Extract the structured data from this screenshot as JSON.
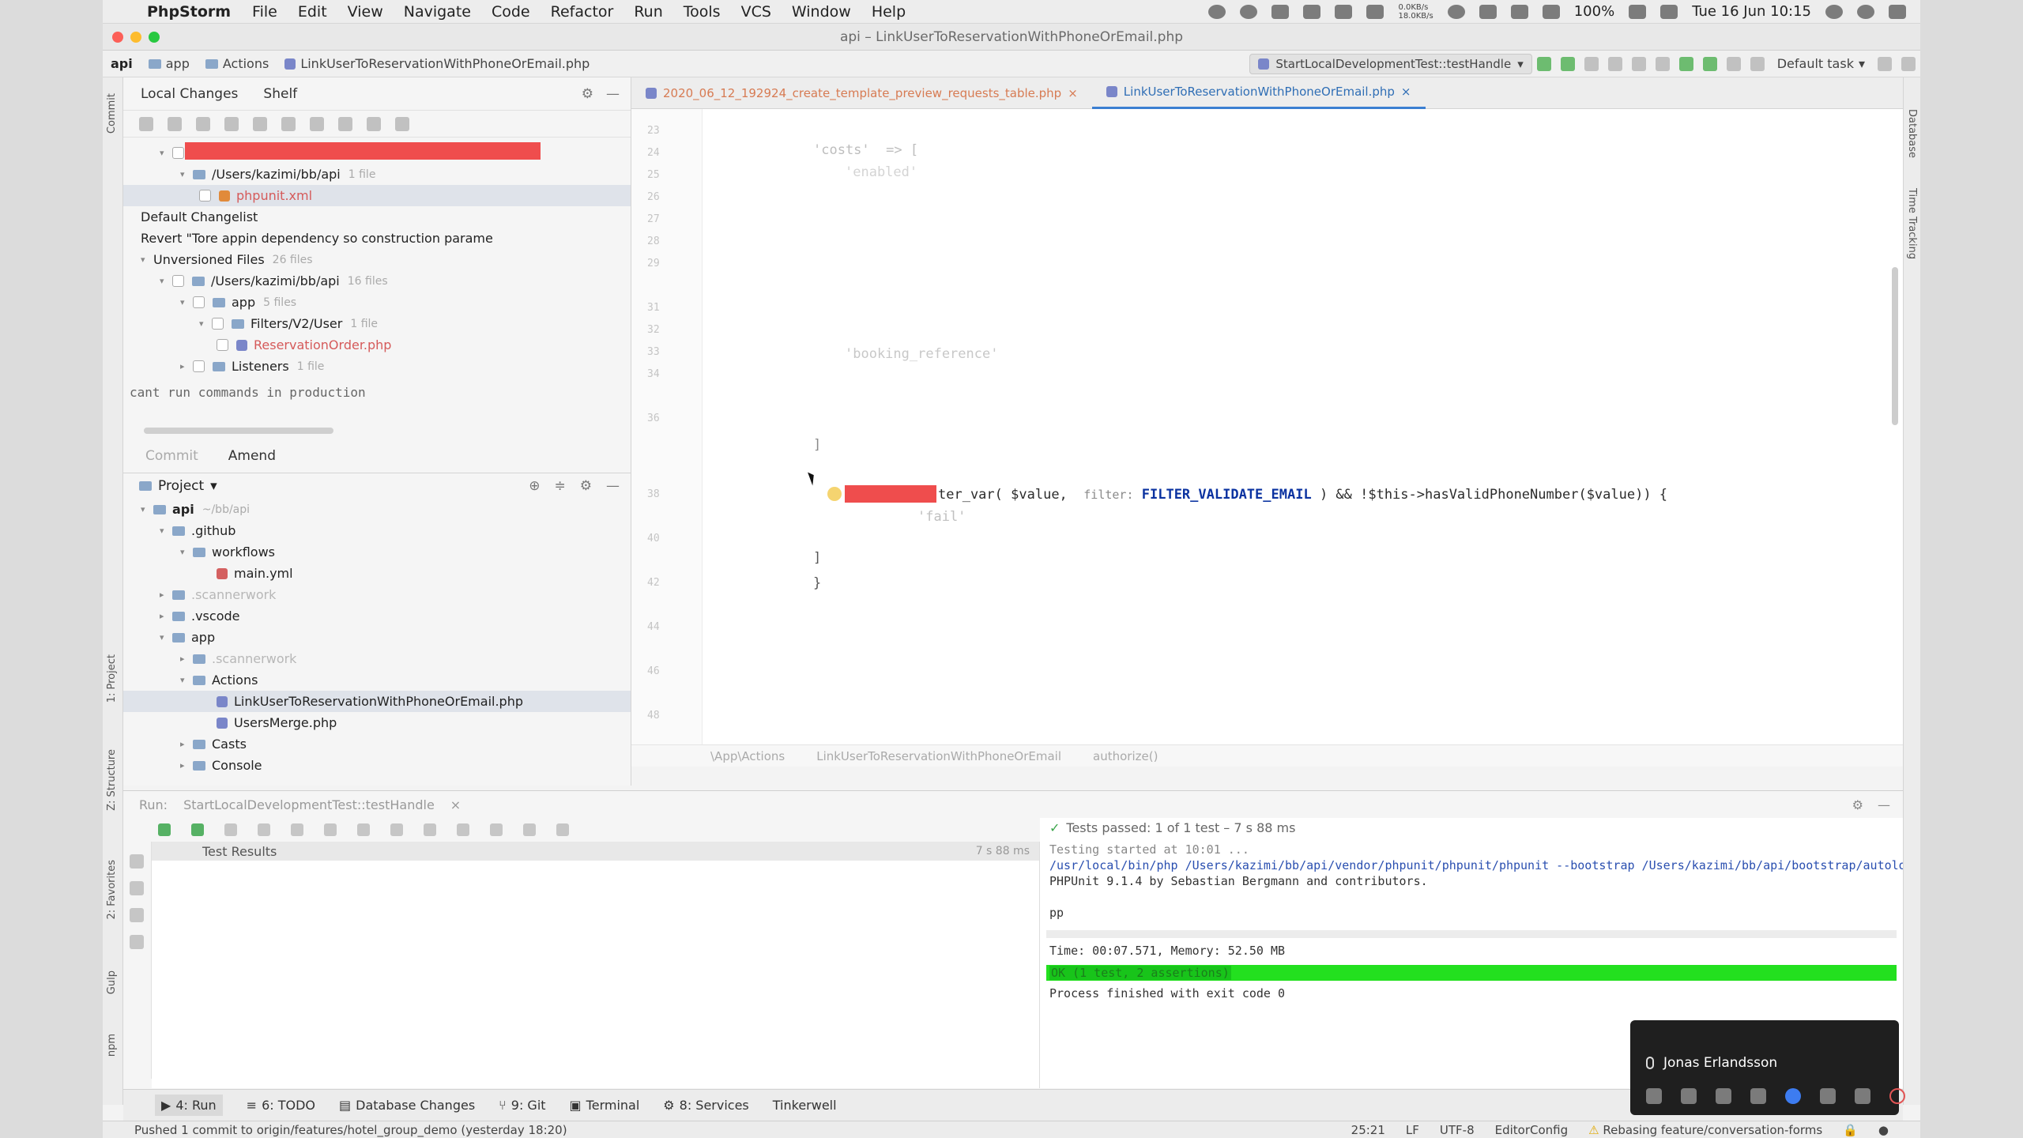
{
  "menubar": {
    "app_name": "PhpStorm",
    "items": [
      "File",
      "Edit",
      "View",
      "Navigate",
      "Code",
      "Refactor",
      "Run",
      "Tools",
      "VCS",
      "Window",
      "Help"
    ],
    "battery": "100%",
    "clock": "Tue 16 Jun  10:15",
    "net_up": "0.0KB/s",
    "net_down": "18.0KB/s"
  },
  "window": {
    "title": "api – LinkUserToReservationWithPhoneOrEmail.php"
  },
  "navbar": {
    "crumbs": [
      "api",
      "app",
      "Actions",
      "LinkUserToReservationWithPhoneOrEmail.php"
    ],
    "run_config": "StartLocalDevelopmentTest::testHandle",
    "task": "Default task"
  },
  "commit_panel": {
    "tabs": [
      "Local Changes",
      "Shelf"
    ],
    "rows": [
      {
        "text": "/Users/kazimi/bb/api",
        "meta": "1 file"
      },
      {
        "text": "phpunit.xml",
        "meta": ""
      },
      {
        "text": "Default Changelist",
        "meta": ""
      },
      {
        "text": "Revert \"Tore appin dependency so construction parame",
        "meta": ""
      },
      {
        "text": "Unversioned Files",
        "meta": "26 files"
      },
      {
        "text": "/Users/kazimi/bb/api",
        "meta": "16 files"
      },
      {
        "text": "app",
        "meta": "5 files"
      },
      {
        "text": "Filters/V2/User",
        "meta": "1 file"
      },
      {
        "text": "ReservationOrder.php",
        "meta": ""
      },
      {
        "text": "Listeners",
        "meta": "1 file"
      }
    ],
    "commit_message": "cant run commands in production",
    "commit_button": "Commit",
    "amend_label": "Amend"
  },
  "project_panel": {
    "title": "Project",
    "rows": [
      {
        "text": "api",
        "meta": "~/bb/api"
      },
      {
        "text": ".github",
        "meta": ""
      },
      {
        "text": "workflows",
        "meta": ""
      },
      {
        "text": "main.yml",
        "meta": ""
      },
      {
        "text": ".scannerwork",
        "meta": ""
      },
      {
        "text": ".vscode",
        "meta": ""
      },
      {
        "text": "app",
        "meta": ""
      },
      {
        "text": ".scannerwork",
        "meta": ""
      },
      {
        "text": "Actions",
        "meta": ""
      },
      {
        "text": "LinkUserToReservationWithPhoneOrEmail.php",
        "meta": ""
      },
      {
        "text": "UsersMerge.php",
        "meta": ""
      },
      {
        "text": "Casts",
        "meta": ""
      },
      {
        "text": "Console",
        "meta": ""
      }
    ]
  },
  "editor": {
    "tabs": [
      "2020_06_12_192924_create_template_preview_requests_table.php",
      "LinkUserToReservationWithPhoneOrEmail.php"
    ],
    "visible_code": {
      "line1": "'costs'  => [",
      "line2": "'enabled'",
      "line3": "'booking_reference'",
      "main_fn": "ter_var(",
      "main_arg1": "$value,",
      "main_hint": "filter:",
      "main_const": "FILTER_VALIDATE_EMAIL",
      "main_rest": ") && !$this->hasValidPhoneNumber($value)) {",
      "line_after": "'fail'",
      "brace1": "]",
      "brace2": "}"
    },
    "breadcrumb": [
      "\\App\\Actions",
      "LinkUserToReservationWithPhoneOrEmail",
      "authorize()"
    ]
  },
  "run_panel": {
    "label": "Run:",
    "config": "StartLocalDevelopmentTest::testHandle",
    "results_title": "Test Results",
    "results_time": "7 s 88 ms",
    "status": "Tests passed: 1 of 1 test – 7 s 88 ms",
    "console_lines": [
      "Testing started at 10:01 ...",
      "/usr/local/bin/php /Users/kazimi/bb/api/vendor/phpunit/phpunit/phpunit --bootstrap /Users/kazimi/bb/api/bootstrap/autoload.p",
      "PHPUnit 9.1.4 by Sebastian Bergmann and contributors.",
      "",
      "pp"
    ],
    "time_line": "Time: 00:07.571, Memory: 52.50 MB",
    "ok_line": "OK (1 test, 2 assertions)",
    "exit_line": "Process finished with exit code 0"
  },
  "toolwindows": [
    {
      "label": "4: Run"
    },
    {
      "label": "6: TODO"
    },
    {
      "label": "Database Changes"
    },
    {
      "label": "9: Git"
    },
    {
      "label": "Terminal"
    },
    {
      "label": "8: Services"
    },
    {
      "label": "Tinkerwell"
    }
  ],
  "statusbar": {
    "message": "Pushed 1 commit to origin/features/hotel_group_demo (yesterday 18:20)",
    "position": "25:21",
    "line_sep": "LF",
    "encoding": "UTF-8",
    "editorconfig": "EditorConfig",
    "git_status": "Rebasing feature/conversation-forms"
  },
  "call_overlay": {
    "participant": "Jonas Erlandsson"
  },
  "stripes": {
    "left": [
      "1: Project",
      "Z: Structure",
      "2: Favorites",
      "Gulp",
      "npm",
      "Commit"
    ],
    "right": [
      "Database",
      "Time Tracking"
    ]
  }
}
